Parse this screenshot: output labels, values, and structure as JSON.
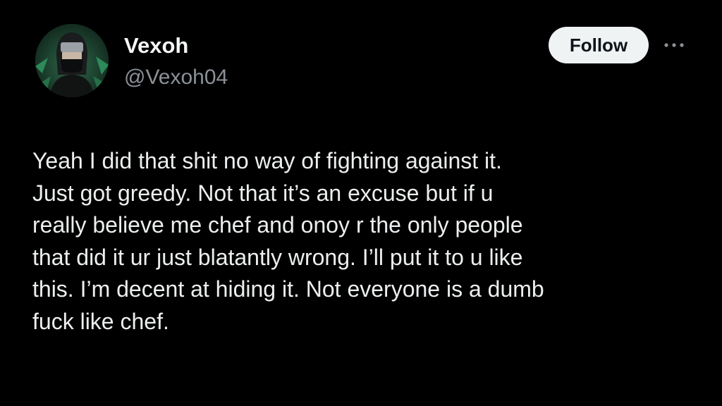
{
  "author": {
    "display_name": "Vexoh",
    "handle": "@Vexoh04",
    "avatar_icon": "avatar-masked-figure"
  },
  "actions": {
    "follow_label": "Follow",
    "more_icon": "more-horizontal-icon"
  },
  "tweet": {
    "lines": [
      "Yeah I did that shit no way of fighting against it.",
      "Just got greedy. Not that it’s an excuse but if u",
      "really believe me chef and onoy r the only people",
      "that did it ur just blatantly wrong. I’ll put it to u like",
      "this. I’m decent at hiding it. Not everyone is a dumb",
      "fuck like chef."
    ]
  },
  "colors": {
    "background": "#000000",
    "text": "#e7e9ea",
    "secondary_text": "#8b9197",
    "button_bg": "#eff3f4",
    "button_text": "#0f1419"
  }
}
